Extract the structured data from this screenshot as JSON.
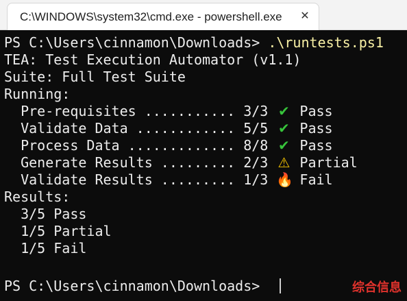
{
  "window": {
    "tab_title": "C:\\WINDOWS\\system32\\cmd.exe - powershell.exe",
    "close_glyph": "✕"
  },
  "console": {
    "prompt1": "PS C:\\Users\\cinnamon\\Downloads> ",
    "command": ".\\runtests.ps1",
    "header1": "TEA: Test Execution Automator (v1.1)",
    "header2": "Suite: Full Test Suite",
    "running_label": "Running:",
    "tests": [
      {
        "prefix": "  Pre-requisites ........... 3/3 ",
        "icon": "✔",
        "icon_name": "check-icon",
        "status": "Pass"
      },
      {
        "prefix": "  Validate Data ............ 5/5 ",
        "icon": "✔",
        "icon_name": "check-icon",
        "status": "Pass"
      },
      {
        "prefix": "  Process Data ............. 8/8 ",
        "icon": "✔",
        "icon_name": "check-icon",
        "status": "Pass"
      },
      {
        "prefix": "  Generate Results ......... 2/3 ",
        "icon": "⚠",
        "icon_name": "warning-icon",
        "status": "Partial"
      },
      {
        "prefix": "  Validate Results ......... 1/3 ",
        "icon": "🔥",
        "icon_name": "fire-icon",
        "status": "Fail"
      }
    ],
    "results_label": "Results:",
    "results": [
      "  3/5 Pass",
      "  1/5 Partial",
      "  1/5 Fail"
    ],
    "prompt2": "PS C:\\Users\\cinnamon\\Downloads> "
  },
  "watermark": "综合信息",
  "colors": {
    "background": "#0c0c0c",
    "text": "#ededed",
    "command": "#f9f1a5",
    "pass": "#37c33b",
    "partial": "#f5c400",
    "fail": "#ff7a1c",
    "watermark": "#e0322c"
  }
}
